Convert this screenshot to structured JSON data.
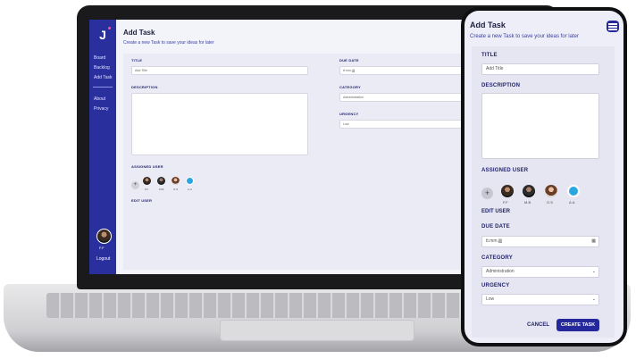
{
  "laptop": {
    "logo": "J",
    "sidebar": {
      "items": [
        "Board",
        "Backlog",
        "Add Task",
        "About",
        "Privacy"
      ],
      "user_initials": "F.F",
      "logout": "Logout"
    },
    "header": {
      "title": "Add Task",
      "subtitle": "Create a new Task to save your ideas for later"
    },
    "form": {
      "title_label": "TITLE",
      "title_placeholder": "Add Title",
      "description_label": "DESCRIPTION",
      "assigned_user_label": "ASSIGNED USER",
      "users": [
        "F.F",
        "M.B",
        "O.S",
        "A.A"
      ],
      "edit_user": "EDIT USER",
      "due_date_label": "DUE DATE",
      "due_date_value": "tt.mm.jjjj",
      "category_label": "CATEGORY",
      "category_value": "Administration",
      "urgency_label": "URGENCY",
      "urgency_value": "Low"
    }
  },
  "phone": {
    "header": {
      "title": "Add Task",
      "subtitle": "Create a new Task to save your ideas for later",
      "menu_icon": "menu-icon"
    },
    "form": {
      "title_label": "TITLE",
      "title_placeholder": "Add Title",
      "description_label": "DESCRIPTION",
      "assigned_user_label": "ASSIGNED USER",
      "users": [
        "F.F",
        "M.B",
        "O.S",
        "A.A"
      ],
      "edit_user": "EDIT USER",
      "due_date_label": "DUE DATE",
      "due_date_value": "tt.mm.jjjj",
      "category_label": "CATEGORY",
      "category_value": "Administration",
      "urgency_label": "URGENCY",
      "urgency_value": "Low"
    },
    "buttons": {
      "cancel": "CANCEL",
      "create": "CREATE TASK"
    }
  },
  "colors": {
    "brand": "#2a2f9e",
    "accent_pink": "#ff4fa0",
    "avatar_active": "#2aa7e0"
  }
}
